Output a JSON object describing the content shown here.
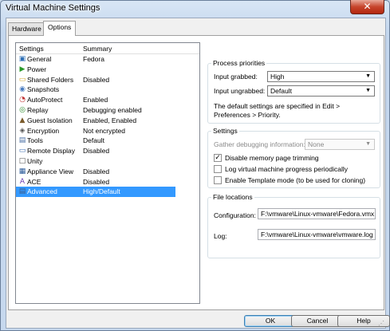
{
  "window": {
    "title": "Virtual Machine Settings",
    "close_glyph": "✕"
  },
  "tabs": {
    "hardware": "Hardware",
    "options": "Options"
  },
  "list": {
    "headers": {
      "settings": "Settings",
      "summary": "Summary"
    },
    "items": [
      {
        "label": "General",
        "summary": "Fedora",
        "icon": "general-icon"
      },
      {
        "label": "Power",
        "summary": "",
        "icon": "power-icon"
      },
      {
        "label": "Shared Folders",
        "summary": "Disabled",
        "icon": "folder-icon"
      },
      {
        "label": "Snapshots",
        "summary": "",
        "icon": "snapshot-icon"
      },
      {
        "label": "AutoProtect",
        "summary": "Enabled",
        "icon": "autoprotect-icon"
      },
      {
        "label": "Replay",
        "summary": "Debugging enabled",
        "icon": "replay-icon"
      },
      {
        "label": "Guest Isolation",
        "summary": "Enabled, Enabled",
        "icon": "lock-icon"
      },
      {
        "label": "Encryption",
        "summary": "Not encrypted",
        "icon": "encryption-icon"
      },
      {
        "label": "Tools",
        "summary": "Default",
        "icon": "tools-icon"
      },
      {
        "label": "Remote Display",
        "summary": "Disabled",
        "icon": "display-icon"
      },
      {
        "label": "Unity",
        "summary": "",
        "icon": "unity-icon"
      },
      {
        "label": "Appliance View",
        "summary": "Disabled",
        "icon": "appliance-icon"
      },
      {
        "label": "ACE",
        "summary": "Disabled",
        "icon": "ace-icon"
      },
      {
        "label": "Advanced",
        "summary": "High/Default",
        "icon": "advanced-icon"
      }
    ],
    "selected_label": "Advanced"
  },
  "process_priorities": {
    "title": "Process priorities",
    "input_grabbed_label": "Input grabbed:",
    "input_grabbed_value": "High",
    "input_ungrabbed_label": "Input ungrabbed:",
    "input_ungrabbed_value": "Default",
    "note": "The default settings are specified in Edit > Preferences > Priority."
  },
  "settings": {
    "title": "Settings",
    "gather_label": "Gather debugging information:",
    "gather_value": "None",
    "checkboxes": [
      {
        "label": "Disable memory page trimming",
        "checked": true
      },
      {
        "label": "Log virtual machine progress periodically",
        "checked": false
      },
      {
        "label": "Enable Template mode (to be used for cloning)",
        "checked": false
      }
    ]
  },
  "file_locations": {
    "title": "File locations",
    "configuration_label": "Configuration:",
    "configuration_value": "F:\\vmware\\Linux-vmware\\Fedora.vmx",
    "log_label": "Log:",
    "log_value": "F:\\vmware\\Linux-vmware\\vmware.log"
  },
  "buttons": {
    "ok": "OK",
    "cancel": "Cancel",
    "help": "Help"
  },
  "colors": {
    "selection": "#3399ff",
    "accent_close": "#c7452c"
  }
}
